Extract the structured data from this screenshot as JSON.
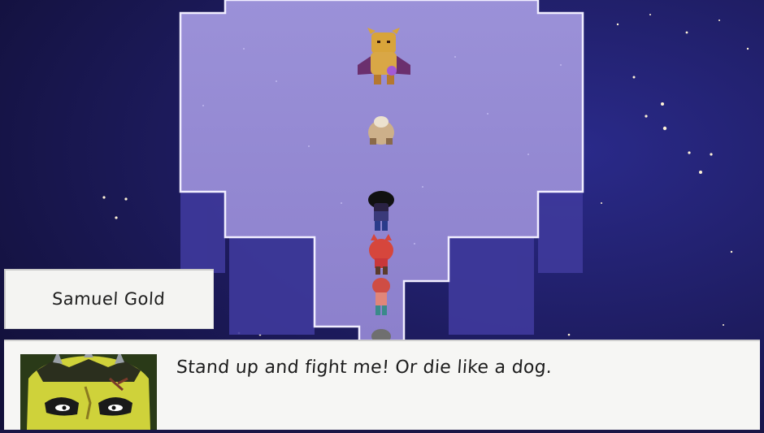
{
  "colors": {
    "sky": "#1a1646",
    "floor": "#9a8fd6",
    "floor_edge": "#ece8ff",
    "dialog_bg": "#f6f6f4",
    "text": "#1c1c1c"
  },
  "dialog": {
    "speaker": "Samuel Gold",
    "line": "Stand up and fight me! Or die like a dog.",
    "portrait_icon": "samuel-gold-portrait"
  },
  "party": {
    "leader_icon": "black-hair-hero-sprite",
    "members_icons": [
      "red-cat-ears-girl-sprite",
      "red-hair-boy-sprite",
      "grey-hair-member-sprite"
    ]
  },
  "enemies": {
    "boss_icon": "golden-demon-boss-sprite",
    "minion_icon": "hunched-old-creature-sprite"
  }
}
